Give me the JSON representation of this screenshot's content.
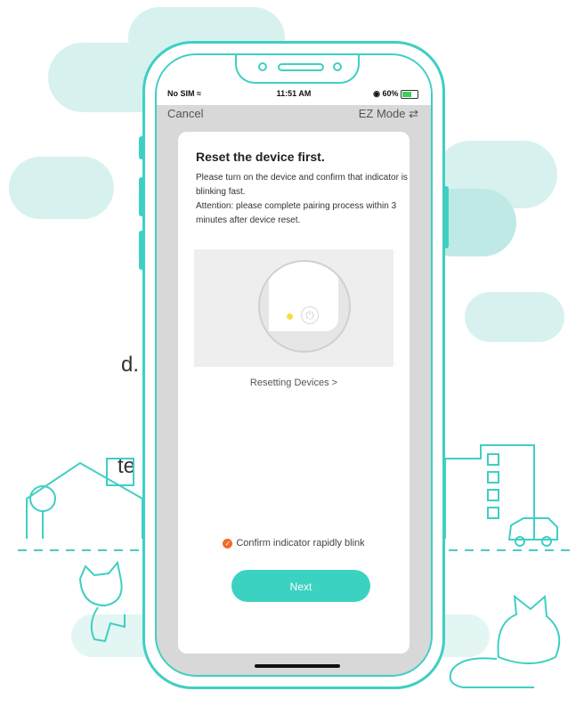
{
  "status": {
    "carrier": "No SIM",
    "time": "11:51 AM",
    "battery": "60%"
  },
  "nav": {
    "cancel": "Cancel",
    "mode": "EZ Mode ⇄"
  },
  "content": {
    "title": "Reset the device first.",
    "line1": "Please turn on the device and confirm that indicator is blinking fast.",
    "line2": "Attention: please complete pairing process within 3 minutes after device reset.",
    "reset_link": "Resetting Devices >",
    "confirm": "Confirm indicator rapidly blink",
    "next": "Next"
  },
  "background_text": {
    "a": "d.",
    "b": "te"
  },
  "colors": {
    "accent": "#3cd2c2",
    "check": "#f06a2c",
    "led": "#f3e03a"
  }
}
